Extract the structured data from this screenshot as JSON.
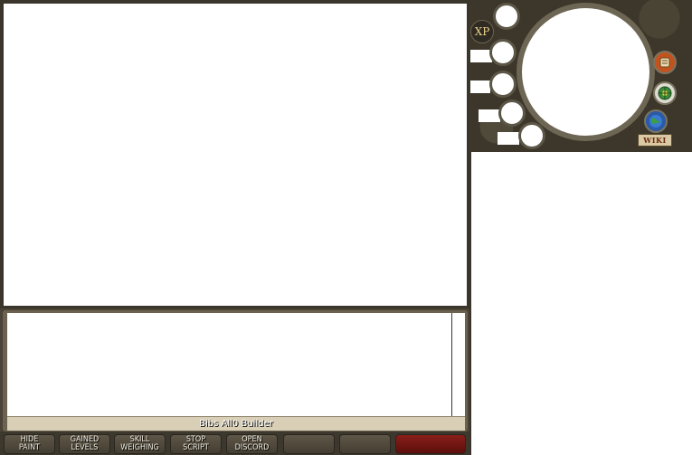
{
  "chatbox": {
    "name_bar": "Bibs All0 Builder"
  },
  "buttons": [
    {
      "label": "HIDE\nPAINT"
    },
    {
      "label": "GAINED\nLEVELS"
    },
    {
      "label": "SKILL\nWEIGHING"
    },
    {
      "label": "STOP\nSCRIPT"
    },
    {
      "label": "OPEN\nDISCORD"
    },
    {
      "label": ""
    },
    {
      "label": ""
    },
    {
      "label": ""
    }
  ],
  "minimap": {
    "xp_label": "XP",
    "wiki_label": "WIKI",
    "icons": [
      "quest-scroll-icon",
      "compass-icon",
      "world-globe-icon"
    ]
  },
  "colors": {
    "frame": "#3b362c",
    "button_red": "#8a1e1a",
    "stone": "#3c372a"
  }
}
